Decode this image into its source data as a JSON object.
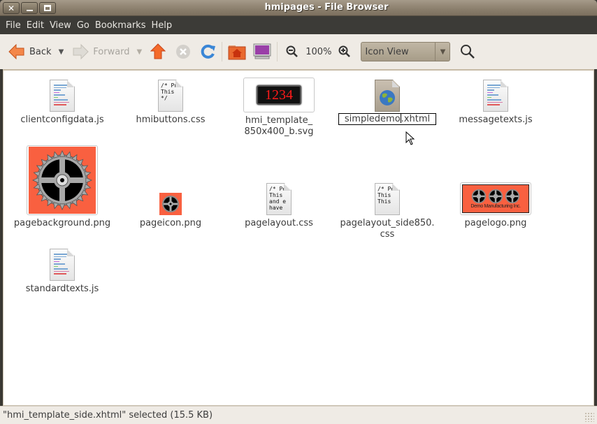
{
  "window": {
    "title": "hmipages - File Browser",
    "controls": [
      "close",
      "minimize",
      "maximize"
    ]
  },
  "menubar": {
    "items": [
      "File",
      "Edit",
      "View",
      "Go",
      "Bookmarks",
      "Help"
    ]
  },
  "toolbar": {
    "back_label": "Back",
    "forward_label": "Forward",
    "zoom_level": "100%",
    "view_mode": "Icon View",
    "icons": {
      "back": "arrow-left-icon",
      "forward": "arrow-right-icon",
      "up": "arrow-up-icon",
      "stop": "stop-icon",
      "reload": "reload-icon",
      "home": "home-folder-icon",
      "computer": "computer-icon",
      "zoom_out": "zoom-out-icon",
      "zoom_in": "zoom-in-icon",
      "search": "search-icon"
    }
  },
  "files": [
    {
      "name": "clientconfigdata.js",
      "type": "js"
    },
    {
      "name": "hmibuttons.css",
      "type": "css",
      "preview": "/* Pu\nThis\n*/"
    },
    {
      "name": "hmi_template_850x400_b.svg",
      "line1": "hmi_template_",
      "line2": "850x400_b.svg",
      "type": "svg",
      "preview": "1234"
    },
    {
      "name": "simpledemo.xhtml",
      "type": "xhtml",
      "renaming": true,
      "rename_before": "simpledemo",
      "rename_after": ".xhtml"
    },
    {
      "name": "messagetexts.js",
      "type": "js"
    },
    {
      "name": "pagebackground.png",
      "type": "png-gear-large"
    },
    {
      "name": "pageicon.png",
      "type": "png-gear-small"
    },
    {
      "name": "pagelayout.css",
      "type": "css",
      "preview": "/* Pe\nThis\nand e\nhave"
    },
    {
      "name": "pagelayout_side850.css",
      "line1": "pagelayout_side850.",
      "line2": "css",
      "type": "css",
      "preview": "/* Pe\nThis\nThis"
    },
    {
      "name": "pagelogo.png",
      "type": "png-logo",
      "logo_text": "Demo Manufacturing Inc."
    },
    {
      "name": "standardtexts.js",
      "type": "js"
    }
  ],
  "statusbar": {
    "text": "\"hmi_template_side.xhtml\" selected (15.5 KB)"
  },
  "colors": {
    "menubar_bg": "#3c3b37",
    "toolbar_bg": "#efebe5",
    "accent_orange": "#ff6040",
    "image_bg": "#f96040"
  }
}
